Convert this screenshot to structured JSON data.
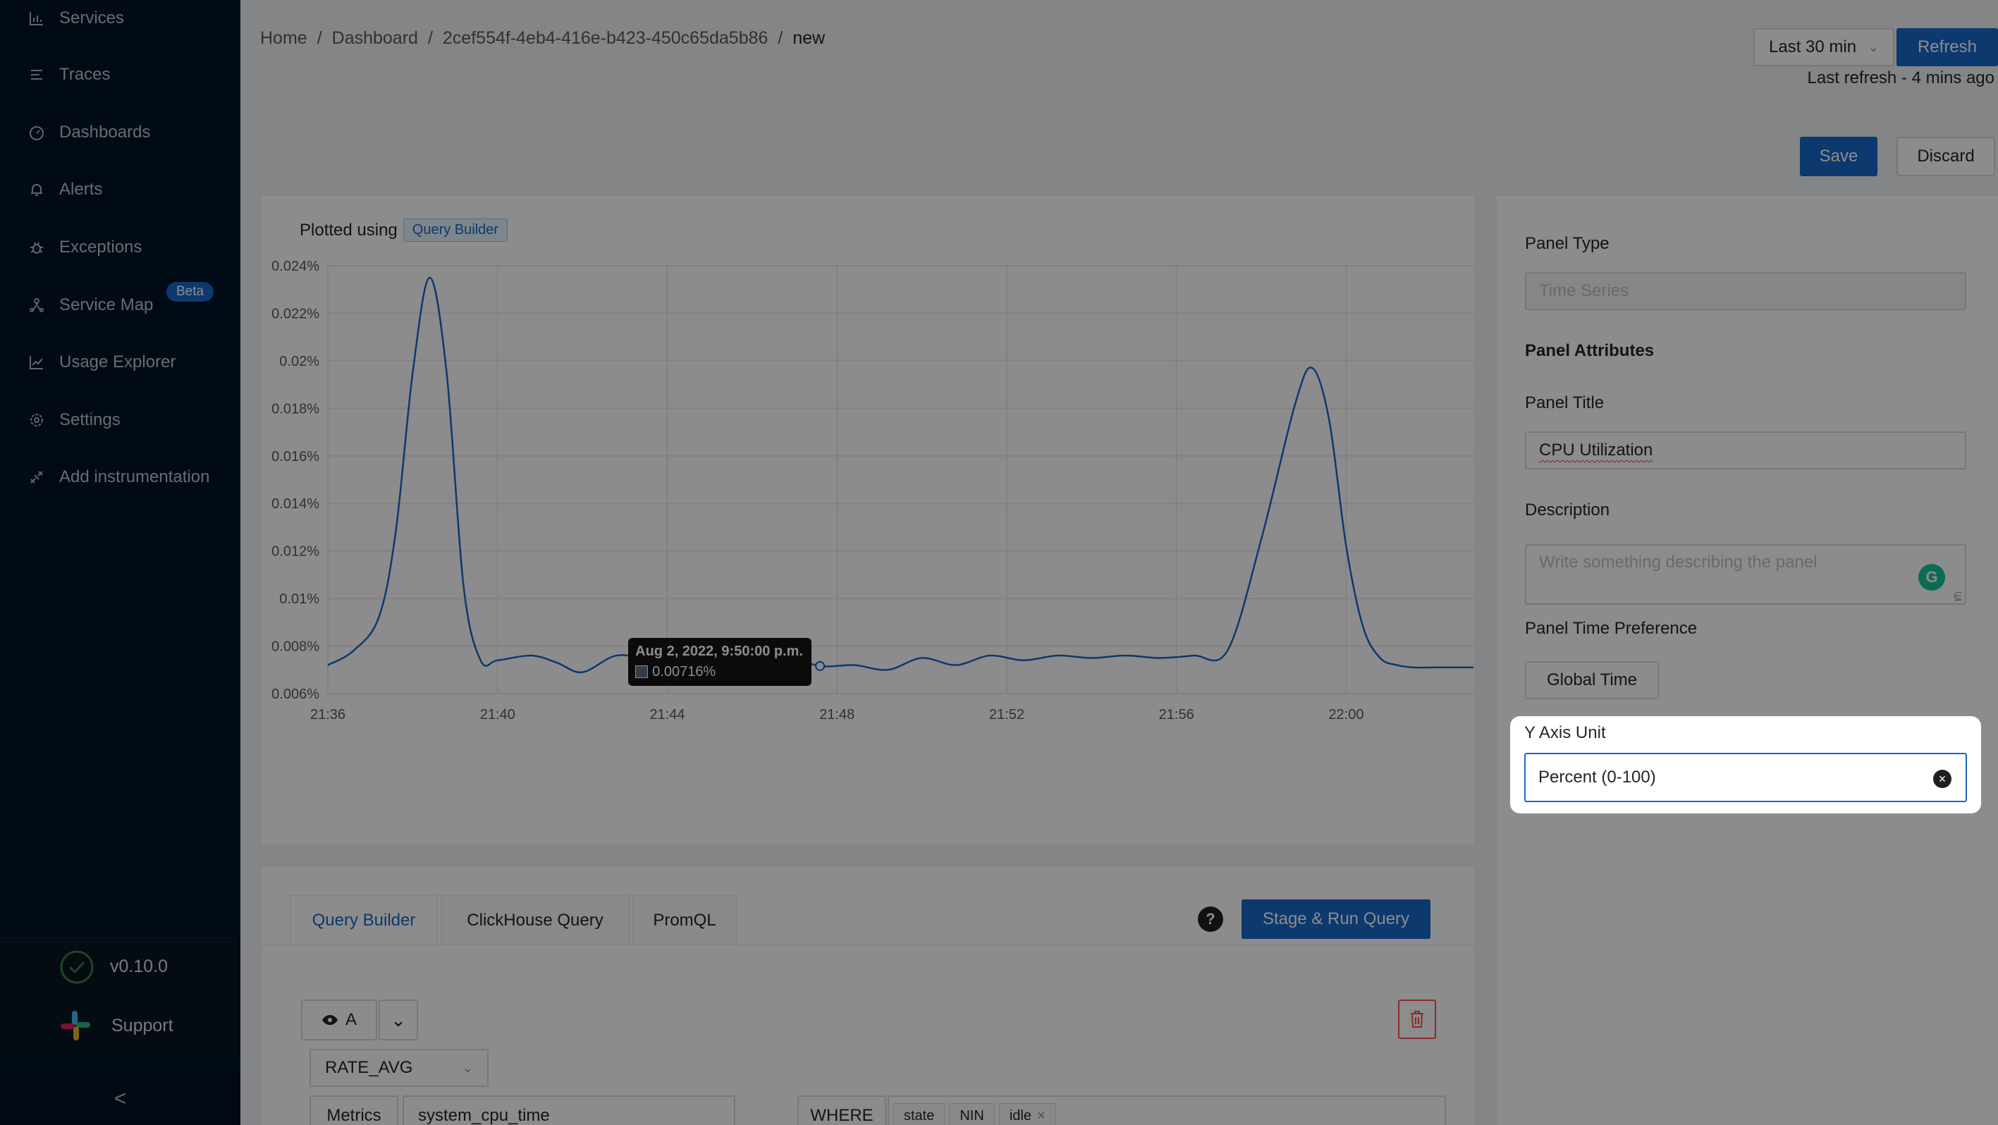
{
  "sidebar": {
    "items": [
      {
        "label": "Services",
        "icon": "bar-chart-icon"
      },
      {
        "label": "Traces",
        "icon": "list-icon"
      },
      {
        "label": "Dashboards",
        "icon": "dashboard-icon"
      },
      {
        "label": "Alerts",
        "icon": "bell-icon"
      },
      {
        "label": "Exceptions",
        "icon": "bug-icon"
      },
      {
        "label": "Service Map",
        "icon": "deployment-icon"
      },
      {
        "label": "Usage Explorer",
        "icon": "line-chart-icon"
      },
      {
        "label": "Settings",
        "icon": "gear-icon"
      },
      {
        "label": "Add instrumentation",
        "icon": "api-icon"
      }
    ],
    "beta_badge": "Beta",
    "version": "v0.10.0",
    "support": "Support",
    "collapse": "<"
  },
  "breadcrumb": {
    "items": [
      "Home",
      "/",
      "Dashboard",
      "/",
      "2cef554f-4eb4-416e-b423-450c65da5b86",
      "/",
      "new"
    ]
  },
  "header": {
    "time_range": "Last 30 min",
    "refresh": "Refresh",
    "last_refresh": "Last refresh - 4 mins ago",
    "save": "Save",
    "discard": "Discard"
  },
  "chart_panel": {
    "plotted_using": "Plotted using",
    "plotted_badge": "Query Builder",
    "tooltip_title": "Aug 2, 2022, 9:50:00 p.m.",
    "tooltip_value": "0.00716%"
  },
  "chart_data": {
    "type": "line",
    "y_ticks": [
      "0.024%",
      "0.022%",
      "0.02%",
      "0.018%",
      "0.016%",
      "0.014%",
      "0.012%",
      "0.01%",
      "0.008%",
      "0.006%"
    ],
    "x_ticks": [
      "21:36",
      "21:40",
      "21:44",
      "21:48",
      "21:52",
      "21:56",
      "22:00"
    ],
    "ylim": [
      0.006,
      0.024
    ],
    "xlim": [
      0,
      27
    ],
    "grid": true,
    "line_color": "#1668c9",
    "series": [
      {
        "x": [
          0,
          0.6,
          1.2,
          1.6,
          2.0,
          2.4,
          2.8,
          3.2,
          3.6,
          4.0,
          4.8,
          5.4,
          6.0,
          6.8,
          7.6,
          8.4,
          9.2,
          10.0,
          10.8,
          11.6,
          12.4,
          13.2,
          14.0,
          14.8,
          15.6,
          16.4,
          17.2,
          18.0,
          18.8,
          19.6,
          20.4,
          21.2,
          22.0,
          22.8,
          23.2,
          23.6,
          24.0,
          24.4,
          24.8,
          25.2,
          25.6,
          26.0,
          27.0
        ],
        "y": [
          0.0072,
          0.0078,
          0.0092,
          0.0128,
          0.0195,
          0.0235,
          0.0195,
          0.0105,
          0.0074,
          0.0074,
          0.0076,
          0.0073,
          0.0069,
          0.0076,
          0.0074,
          0.0072,
          0.0077,
          0.0078,
          0.0076,
          0.00716,
          0.0072,
          0.007,
          0.0075,
          0.0072,
          0.0076,
          0.0074,
          0.0076,
          0.0075,
          0.0076,
          0.0075,
          0.0076,
          0.0078,
          0.0125,
          0.0182,
          0.0197,
          0.0175,
          0.0122,
          0.0088,
          0.0075,
          0.0072,
          0.0071,
          0.0071,
          0.0071
        ]
      }
    ],
    "tooltip_point": {
      "x": 11.6,
      "y": 0.00716
    }
  },
  "query_panel": {
    "tabs": [
      "Query Builder",
      "ClickHouse Query",
      "PromQL"
    ],
    "help": "?",
    "run_button": "Stage & Run Query",
    "query_name": "A",
    "aggregate": "RATE_AVG",
    "metrics_label": "Metrics",
    "metrics_value": "system_cpu_time",
    "where_label": "WHERE",
    "where_tags": [
      "state",
      "NIN",
      "idle"
    ]
  },
  "right_panel": {
    "panel_type_label": "Panel Type",
    "panel_type_value": "Time Series",
    "attributes_heading": "Panel Attributes",
    "title_label": "Panel Title",
    "title_value": "CPU Utilization",
    "description_label": "Description",
    "description_placeholder": "Write something describing the  panel",
    "time_pref_label": "Panel Time Preference",
    "time_pref_value": "Global Time",
    "y_unit_label": "Y Axis Unit",
    "y_unit_value": "Percent (0-100)"
  }
}
